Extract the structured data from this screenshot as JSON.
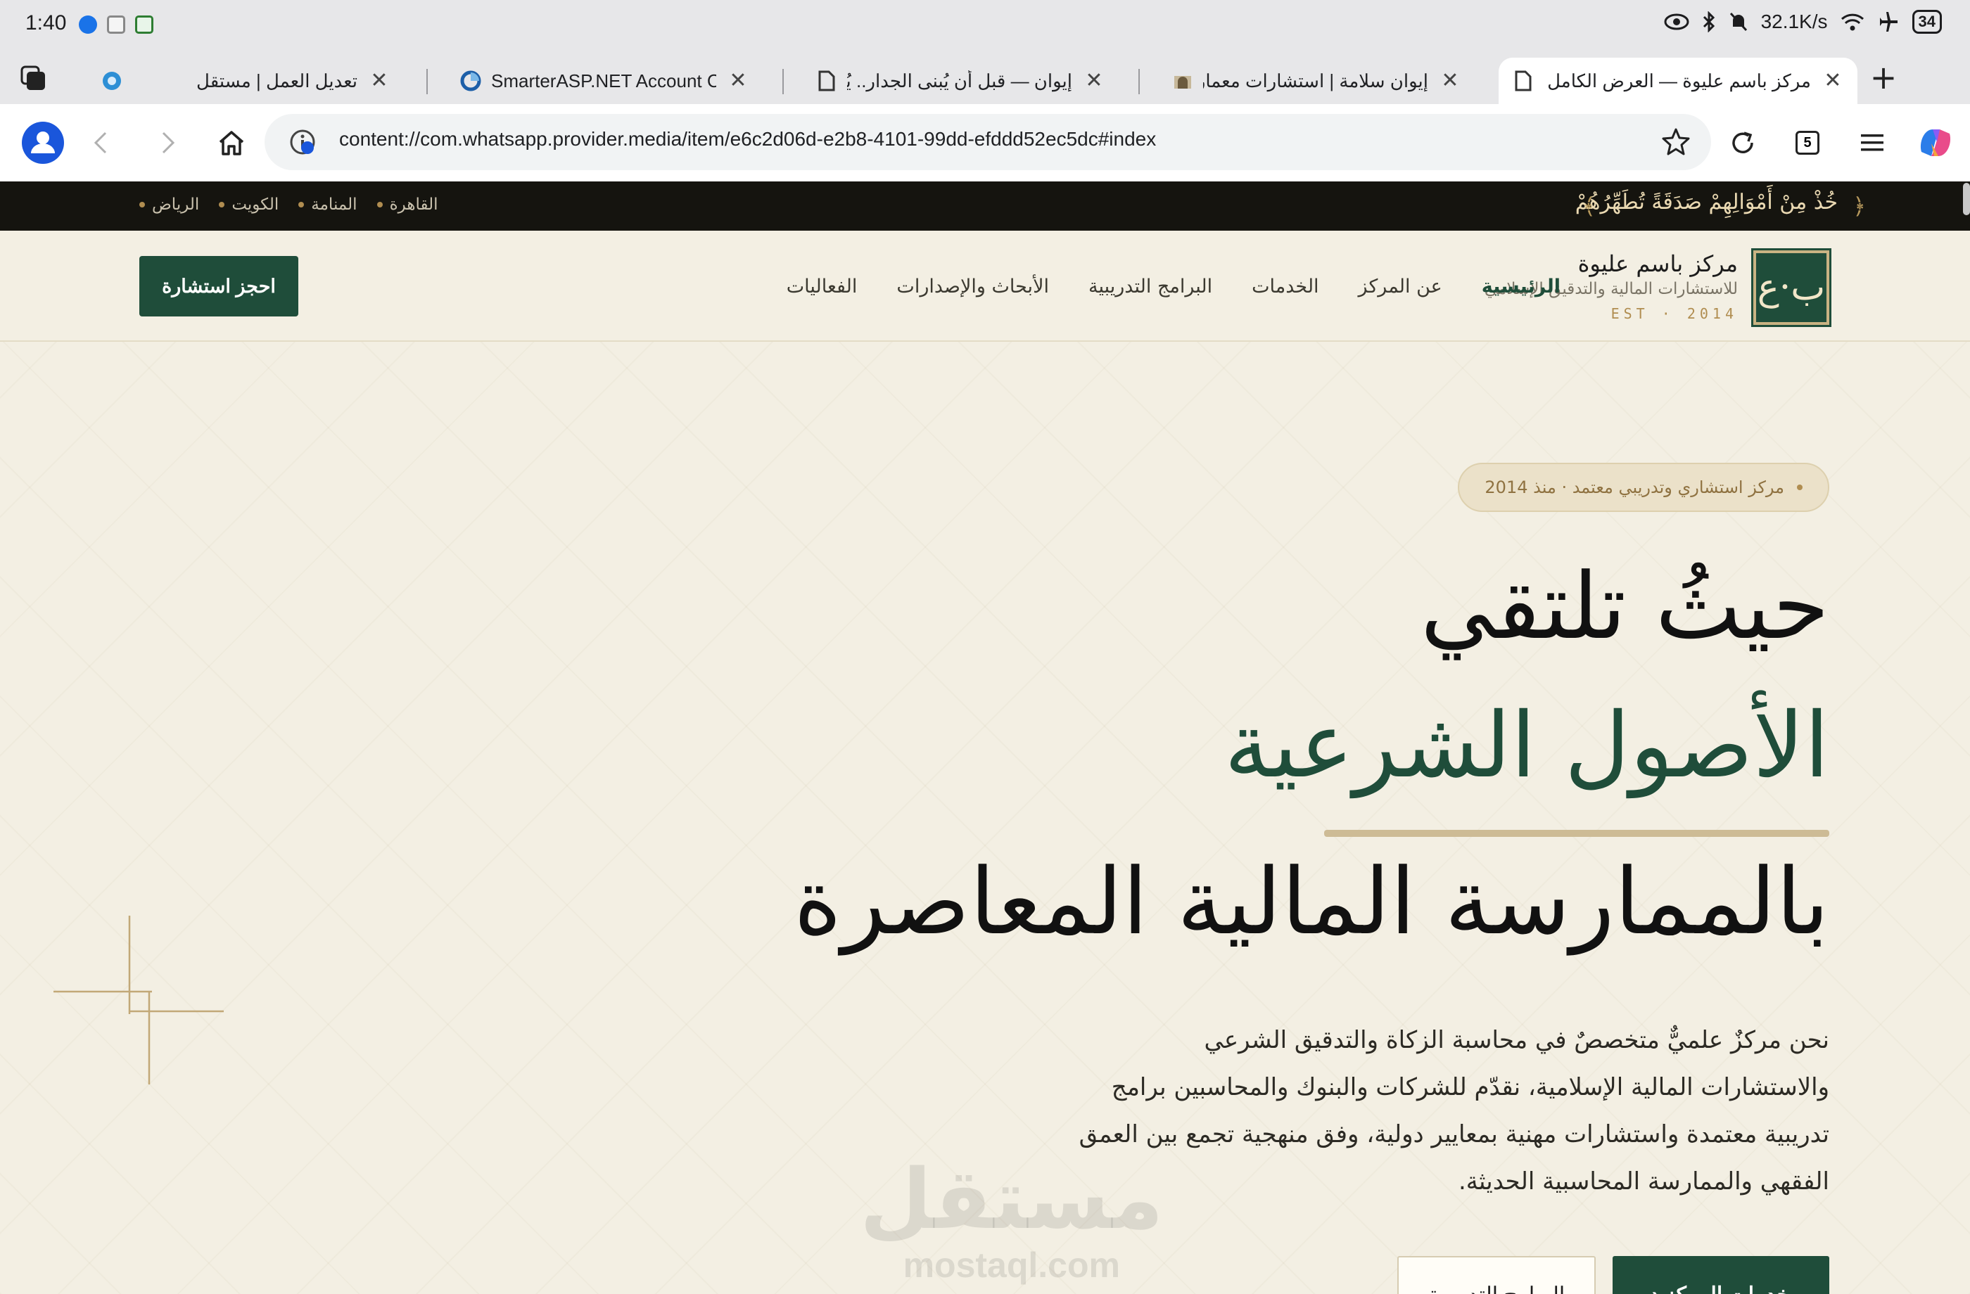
{
  "status_bar": {
    "time": "1:40",
    "net_speed": "32.1K/s",
    "battery": "34",
    "icons": [
      "eye-icon",
      "bluetooth-icon",
      "mute-icon",
      "wifi-icon",
      "airplane-icon"
    ]
  },
  "tabs": [
    {
      "title": "تعديل العمل | مستقل",
      "favicon": "mostaql-icon",
      "active": false
    },
    {
      "title": "SmarterASP.NET Account Control Panel",
      "favicon": "smarterasp-icon",
      "active": false
    },
    {
      "title": "إيوان — قبل أن يُبنى الجدار.. يُبنى الرأي",
      "favicon": "document-icon",
      "active": false
    },
    {
      "title": "إيوان سلامة | استشارات معمارية وهندسية",
      "favicon": "iwan-icon",
      "active": false
    },
    {
      "title": "مركز باسم عليوة — العرض الكامل",
      "favicon": "document-icon",
      "active": true
    }
  ],
  "toolbar": {
    "url": "content://com.whatsapp.provider.media/item/e6c2d06d-e2b8-4101-99dd-efddd52ec5dc#index",
    "tab_count": "5"
  },
  "site": {
    "verse": "خُذْ مِنْ أَمْوَالِهِمْ صَدَقَةً تُطَهِّرُهُمْ",
    "verse_open": "﴿",
    "verse_close": "﴾",
    "cities": [
      "القاهرة",
      "المنامة",
      "الكويت",
      "الرياض"
    ],
    "logo_mark": "ب·ع",
    "brand_name": "مركز باسم عليوة",
    "brand_sub": "للاستشارات المالية والتدقيق الإسلامي",
    "brand_est": "EST · 2014",
    "nav": [
      "الرئيسية",
      "عن المركز",
      "الخدمات",
      "البرامج التدريبية",
      "الأبحاث والإصدارات",
      "الفعاليات"
    ],
    "cta": "احجز استشارة"
  },
  "hero": {
    "badge": "مركز استشاري وتدريبي معتمد · منذ 2014",
    "title_line1": "حيثُ تلتقي",
    "title_line2": "الأصول الشرعية",
    "title_line3": "بالممارسة المالية المعاصرة",
    "lead": "نحن مركزٌ علميٌّ متخصصٌ في محاسبة الزكاة والتدقيق الشرعي والاستشارات المالية الإسلامية، نقدّم للشركات والبنوك والمحاسبين برامج تدريبية معتمدة واستشارات مهنية بمعايير دولية، وفق منهجية تجمع بين العمق الفقهي والممارسة المحاسبية الحديثة.",
    "primary_button": "خدمات المركز ‹",
    "secondary_button": "البرامج التدريبية"
  },
  "watermark": {
    "arabic": "مستقل",
    "latin": "mostaql.com"
  },
  "colors": {
    "brand_green": "#1f4d3a",
    "gold": "#b08d50",
    "cream": "#f3efe3",
    "dark_bar": "#15140f"
  }
}
